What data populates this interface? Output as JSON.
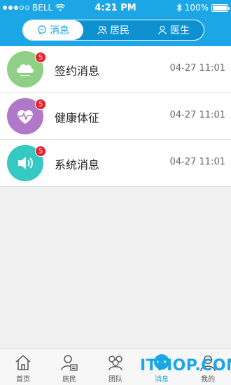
{
  "status_bar": {
    "carrier": "BELL",
    "time": "4:21 PM",
    "battery_percent": "100%"
  },
  "segments": [
    {
      "label": "消息",
      "icon": "chat-bubble-icon",
      "active": true
    },
    {
      "label": "居民",
      "icon": "group-icon",
      "active": false
    },
    {
      "label": "医生",
      "icon": "person-icon",
      "active": false
    }
  ],
  "messages": [
    {
      "title": "签约消息",
      "time": "04-27 11:01",
      "badge": "5",
      "icon": "contract-cloud-icon",
      "color": "#8fcf86"
    },
    {
      "title": "健康体征",
      "time": "04-27 11:01",
      "badge": "5",
      "icon": "heart-pulse-icon",
      "color": "#b177c9"
    },
    {
      "title": "系统消息",
      "time": "04-27 11:01",
      "badge": "5",
      "icon": "speaker-icon",
      "color": "#35c9c3"
    }
  ],
  "tabbar": [
    {
      "label": "首页",
      "icon": "home-icon"
    },
    {
      "label": "居民",
      "icon": "resident-icon"
    },
    {
      "label": "团队",
      "icon": "team-icon"
    },
    {
      "label": "消息",
      "icon": "message-icon"
    },
    {
      "label": "我的",
      "icon": "profile-icon"
    }
  ],
  "watermark": "ITMOP.COM",
  "colors": {
    "accent": "#1ca6e6",
    "badge": "#e8202a"
  }
}
